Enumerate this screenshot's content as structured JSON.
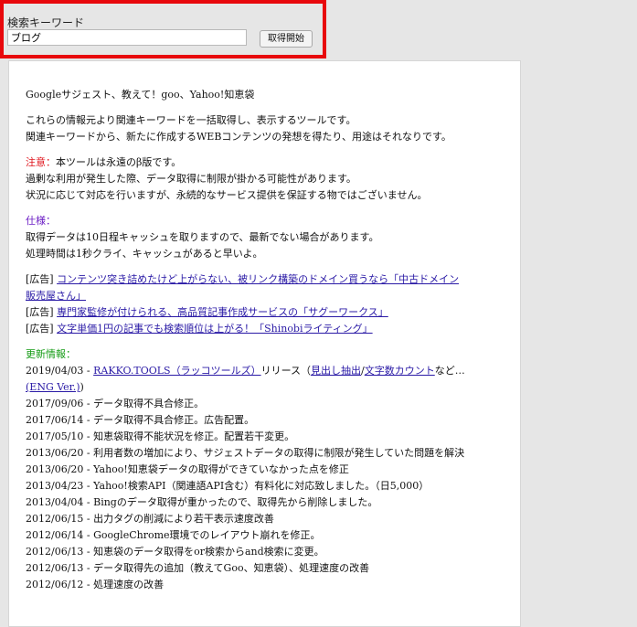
{
  "search": {
    "label": "検索キーワード",
    "value": "ブログ",
    "button": "取得開始"
  },
  "main": {
    "title": "Googleサジェスト、教えて！goo、Yahoo!知恵袋",
    "intro": [
      "これらの情報元より関連キーワードを一括取得し、表示するツールです。",
      "関連キーワードから、新たに作成するWEBコンテンツの発想を得たり、用途はそれなりです。"
    ],
    "notice": {
      "heading": "注意：",
      "text": "本ツールは永遠のβ版です。",
      "lines": [
        "過剰な利用が発生した際、データ取得に制限が掛かる可能性があります。",
        "状況に応じて対応を行いますが、永続的なサービス提供を保証する物ではございません。"
      ]
    },
    "spec": {
      "heading": "仕様：",
      "lines": [
        "取得データは10日程キャッシュを取りますので、最新でない場合があります。",
        "処理時間は1秒クライ、キャッシュがあると早いよ。"
      ]
    },
    "ads": [
      {
        "prefix": "[広告]",
        "link_a": "コンテンツ突き詰めたけど上がらない、被リンク構築のドメイン買うなら「中古ドメイン",
        "link_b": "販売屋さん」"
      },
      {
        "prefix": "[広告]",
        "link": "専門家監修が付けられる、高品質記事作成サービスの「サグーワークス」"
      },
      {
        "prefix": "[広告]",
        "link": "文字単価1円の記事でも検索順位は上がる！「Shinobiライティング」"
      }
    ],
    "updates": {
      "heading": "更新情報：",
      "first": {
        "date": "2019/04/03 - ",
        "link1": "RAKKO.TOOLS（ラッコツールズ）",
        "mid1": "リリース（",
        "link2": "見出し抽出",
        "sep": "/",
        "link3": "文字数カウント",
        "mid2": "など…",
        "link4": "(ENG Ver.)",
        "end": ")"
      },
      "items": [
        "2017/09/06 - データ取得不具合修正。",
        "2017/06/14 - データ取得不具合修正。広告配置。",
        "2017/05/10 - 知恵袋取得不能状況を修正。配置若干変更。",
        "2013/06/20 - 利用者数の増加により、サジェストデータの取得に制限が発生していた問題を解決",
        "2013/06/20 - Yahoo!知恵袋データの取得ができていなかった点を修正",
        "2013/04/23 - Yahoo!検索API（関連語API含む）有料化に対応致しました。（日5,000）",
        "2013/04/04 - Bingのデータ取得が重かったので、取得先から削除しました。",
        "2012/06/15 - 出力タグの削減により若干表示速度改善",
        "2012/06/14 - GoogleChrome環境でのレイアウト崩れを修正。",
        "2012/06/13 - 知恵袋のデータ取得をor検索からand検索に変更。",
        "2012/06/13 - データ取得先の追加（教えてGoo、知恵袋）、処理速度の改善",
        "2012/06/12 - 処理速度の改善"
      ]
    }
  }
}
